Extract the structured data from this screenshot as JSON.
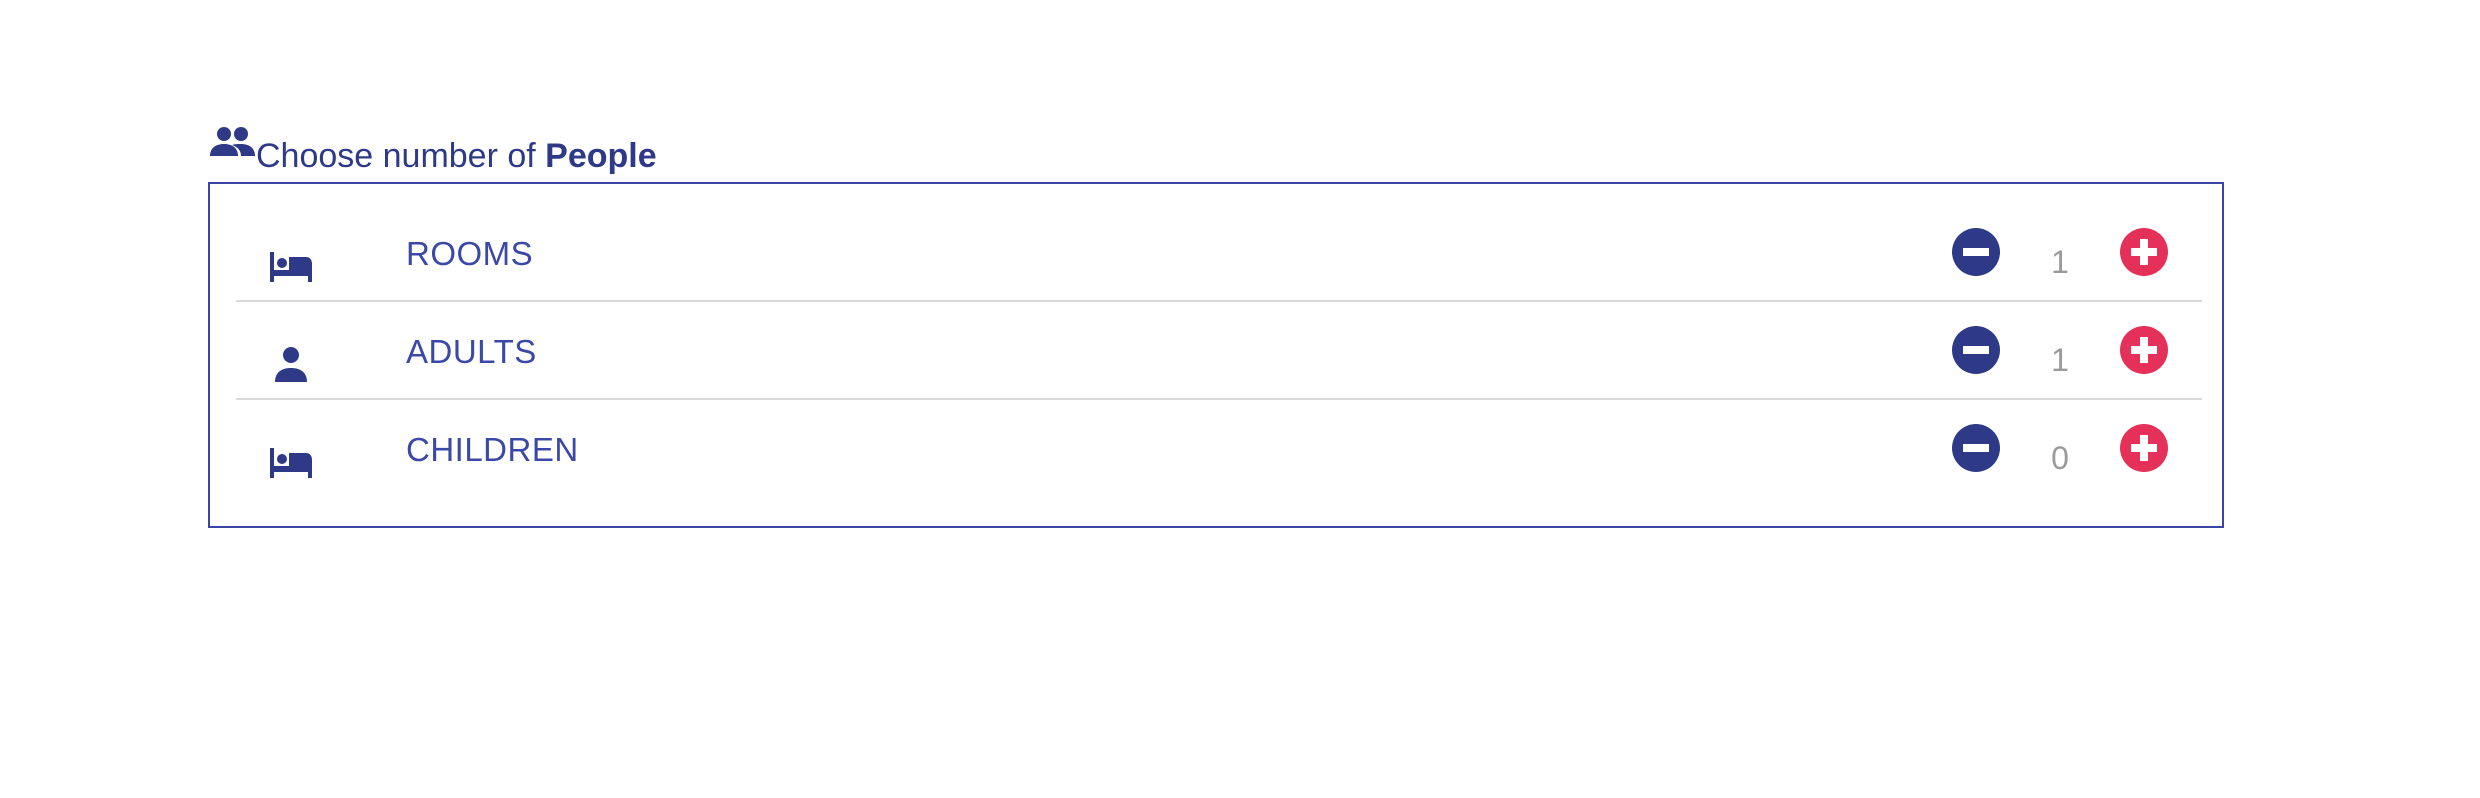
{
  "header": {
    "icon": "people-icon",
    "title_prefix": "Choose number of ",
    "title_bold": "People"
  },
  "rows": [
    {
      "icon": "bed-icon",
      "label": "ROOMS",
      "value": "1"
    },
    {
      "icon": "person-icon",
      "label": "ADULTS",
      "value": "1"
    },
    {
      "icon": "bed-icon",
      "label": "CHILDREN",
      "value": "0"
    }
  ],
  "colors": {
    "primary": "#2e3a87",
    "label": "#3a48a8",
    "accent": "#e5305a",
    "count": "#9a9a9a",
    "border": "#3b45a6",
    "divider": "#d9d9d9"
  }
}
